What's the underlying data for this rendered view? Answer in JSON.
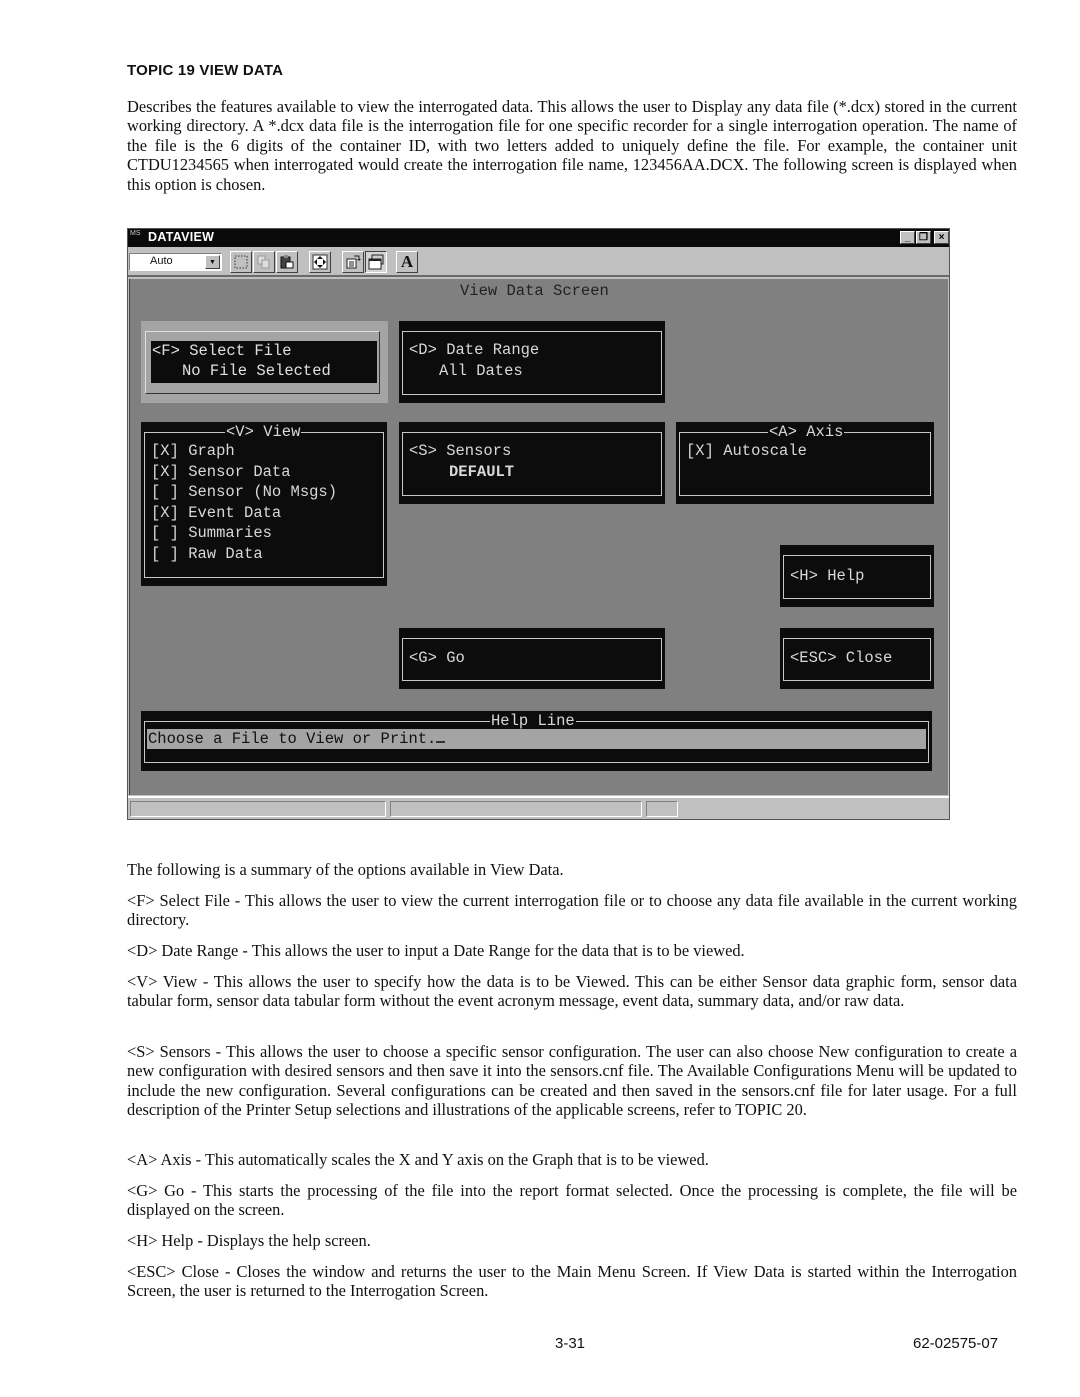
{
  "topic": {
    "title": "TOPIC 19  VIEW DATA"
  },
  "intro": "Describes the features available to view the interrogated data. This allows the user to Display any data file (*.dcx) stored in the current working directory. A *.dcx data file is the interrogation file for one specific recorder for a single interrogation operation. The name of the file is the 6 digits of the container ID, with two letters added to uniquely define the file. For example, the container unit CTDU1234565 when interrogated would create the interrogation file name, 123456AA.DCX. The following screen is displayed when this option is chosen.",
  "window": {
    "app_icon": "MS",
    "title": "DATAVIEW",
    "controls": {
      "minimize": "_",
      "restore": "🗗",
      "close": "×"
    },
    "toolbar": {
      "font_size_value": "Auto",
      "buttons": [
        {
          "name": "select-rect",
          "icon": "dotted-rect-icon"
        },
        {
          "name": "copy",
          "icon": "copy-icon"
        },
        {
          "name": "paste",
          "icon": "paste-icon"
        },
        {
          "name": "fullscreen",
          "icon": "fullscreen-arrows-icon"
        },
        {
          "name": "properties",
          "icon": "properties-icon"
        },
        {
          "name": "background",
          "icon": "window-icon"
        },
        {
          "name": "font",
          "icon": "font-a-icon",
          "label": "A"
        }
      ]
    },
    "screen": {
      "title": "View Data Screen",
      "select_file": {
        "label": "<F> Select File",
        "value": "No File Selected"
      },
      "date_range": {
        "label": "<D> Date Range",
        "value": "All Dates"
      },
      "view": {
        "title": "<V> View",
        "options": [
          {
            "checked": true,
            "label": "Graph",
            "text": "[X] Graph"
          },
          {
            "checked": true,
            "label": "Sensor Data",
            "text": "[X] Sensor Data"
          },
          {
            "checked": false,
            "label": "Sensor (No Msgs)",
            "text": "[ ] Sensor (No Msgs)"
          },
          {
            "checked": true,
            "label": "Event Data",
            "text": "[X] Event Data"
          },
          {
            "checked": false,
            "label": "Summaries",
            "text": "[ ] Summaries"
          },
          {
            "checked": false,
            "label": "Raw Data",
            "text": "[ ] Raw Data"
          }
        ]
      },
      "sensors": {
        "label": "<S> Sensors",
        "value": "DEFAULT"
      },
      "axis": {
        "title": "<A> Axis",
        "options": [
          {
            "checked": true,
            "label": "Autoscale",
            "text": "[X] Autoscale"
          }
        ]
      },
      "help": {
        "label": "<H> Help"
      },
      "go": {
        "label": "<G> Go"
      },
      "close": {
        "label": "<ESC> Close"
      },
      "help_line": {
        "title": "Help Line",
        "text": "Choose a File to View or Print."
      }
    }
  },
  "summary_intro": "The following is a summary of the options available in View Data.",
  "descriptions": [
    "<F> Select File - This allows the user to view the current interrogation file or to choose any data file available in the current working directory.",
    "<D> Date Range - This allows the user to input a Date Range for the data that is to be viewed.",
    "<V> View - This allows the user to specify how the data is to be Viewed. This can be either Sensor data graphic form, sensor data tabular form, sensor data tabular form without the event acronym message, event data, summary data, and/or raw data.",
    "<S> Sensors - This allows the user to choose a specific sensor configuration. The user can also choose New configuration to create a new configuration with desired sensors and then save it into the sensors.cnf file. The Available Configurations Menu will be updated to include the new configuration. Several configurations can be created and then saved in the sensors.cnf file for later usage. For a full description of the Printer Setup selections and illustrations of the applicable screens, refer to TOPIC 20.",
    "<A> Axis - This automatically scales the X and Y axis on the Graph that is to be viewed.",
    "<G> Go - This starts the processing of the file into the report format selected. Once the processing is complete, the file will be displayed on the screen.",
    "<H> Help - Displays the help screen.",
    "<ESC> Close - Closes the window and returns the user to the Main Menu Screen. If View Data is started within the Interrogation Screen, the user is returned to the Interrogation Screen."
  ],
  "footer": {
    "page_number": "3-31",
    "doc_number": "62-02575-07"
  }
}
